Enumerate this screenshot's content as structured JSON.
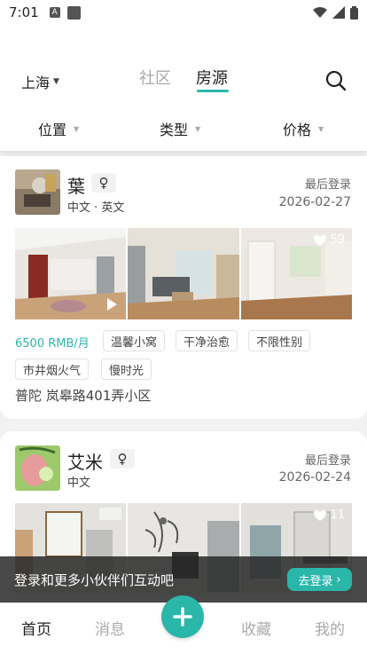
{
  "status": {
    "time": "7:01",
    "notif_icon": "A"
  },
  "header": {
    "city": "上海",
    "tabs": [
      {
        "label": "社区",
        "active": false
      },
      {
        "label": "房源",
        "active": true
      }
    ],
    "accent_color": "#2ab7aa"
  },
  "filters": [
    {
      "label": "位置"
    },
    {
      "label": "类型"
    },
    {
      "label": "价格"
    }
  ],
  "listings": [
    {
      "name": "葉",
      "gender": "♀",
      "languages": "中文 · 英文",
      "last_login_label": "最后登录",
      "last_login_date": "2026-02-27",
      "likes": "59",
      "price": "6500 RMB/月",
      "tags": [
        "温馨小窝",
        "干净治愈",
        "不限性别",
        "市井烟火气",
        "慢时光"
      ],
      "address": "普陀 岚皋路401弄小区"
    },
    {
      "name": "艾米",
      "gender": "♀",
      "languages": "中文",
      "last_login_label": "最后登录",
      "last_login_date": "2026-02-24",
      "likes": "11"
    }
  ],
  "login_banner": {
    "text": "登录和更多小伙伴们互动吧",
    "button": "去登录"
  },
  "bottom_nav": [
    {
      "label": "首页"
    },
    {
      "label": "消息"
    },
    {
      "label": "收藏"
    },
    {
      "label": "我的"
    }
  ]
}
